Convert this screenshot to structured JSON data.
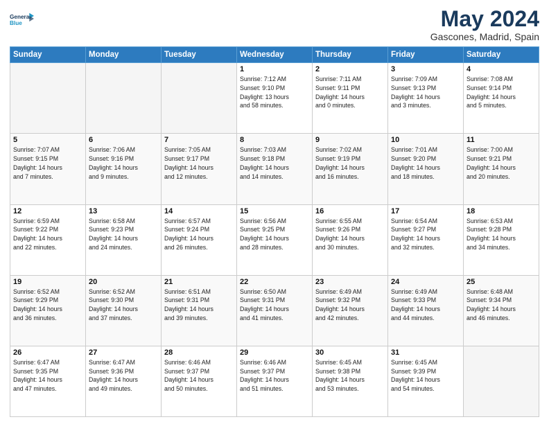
{
  "header": {
    "logo_line1": "General",
    "logo_line2": "Blue",
    "month": "May 2024",
    "location": "Gascones, Madrid, Spain"
  },
  "weekdays": [
    "Sunday",
    "Monday",
    "Tuesday",
    "Wednesday",
    "Thursday",
    "Friday",
    "Saturday"
  ],
  "weeks": [
    [
      {
        "day": "",
        "info": ""
      },
      {
        "day": "",
        "info": ""
      },
      {
        "day": "",
        "info": ""
      },
      {
        "day": "1",
        "info": "Sunrise: 7:12 AM\nSunset: 9:10 PM\nDaylight: 13 hours\nand 58 minutes."
      },
      {
        "day": "2",
        "info": "Sunrise: 7:11 AM\nSunset: 9:11 PM\nDaylight: 14 hours\nand 0 minutes."
      },
      {
        "day": "3",
        "info": "Sunrise: 7:09 AM\nSunset: 9:13 PM\nDaylight: 14 hours\nand 3 minutes."
      },
      {
        "day": "4",
        "info": "Sunrise: 7:08 AM\nSunset: 9:14 PM\nDaylight: 14 hours\nand 5 minutes."
      }
    ],
    [
      {
        "day": "5",
        "info": "Sunrise: 7:07 AM\nSunset: 9:15 PM\nDaylight: 14 hours\nand 7 minutes."
      },
      {
        "day": "6",
        "info": "Sunrise: 7:06 AM\nSunset: 9:16 PM\nDaylight: 14 hours\nand 9 minutes."
      },
      {
        "day": "7",
        "info": "Sunrise: 7:05 AM\nSunset: 9:17 PM\nDaylight: 14 hours\nand 12 minutes."
      },
      {
        "day": "8",
        "info": "Sunrise: 7:03 AM\nSunset: 9:18 PM\nDaylight: 14 hours\nand 14 minutes."
      },
      {
        "day": "9",
        "info": "Sunrise: 7:02 AM\nSunset: 9:19 PM\nDaylight: 14 hours\nand 16 minutes."
      },
      {
        "day": "10",
        "info": "Sunrise: 7:01 AM\nSunset: 9:20 PM\nDaylight: 14 hours\nand 18 minutes."
      },
      {
        "day": "11",
        "info": "Sunrise: 7:00 AM\nSunset: 9:21 PM\nDaylight: 14 hours\nand 20 minutes."
      }
    ],
    [
      {
        "day": "12",
        "info": "Sunrise: 6:59 AM\nSunset: 9:22 PM\nDaylight: 14 hours\nand 22 minutes."
      },
      {
        "day": "13",
        "info": "Sunrise: 6:58 AM\nSunset: 9:23 PM\nDaylight: 14 hours\nand 24 minutes."
      },
      {
        "day": "14",
        "info": "Sunrise: 6:57 AM\nSunset: 9:24 PM\nDaylight: 14 hours\nand 26 minutes."
      },
      {
        "day": "15",
        "info": "Sunrise: 6:56 AM\nSunset: 9:25 PM\nDaylight: 14 hours\nand 28 minutes."
      },
      {
        "day": "16",
        "info": "Sunrise: 6:55 AM\nSunset: 9:26 PM\nDaylight: 14 hours\nand 30 minutes."
      },
      {
        "day": "17",
        "info": "Sunrise: 6:54 AM\nSunset: 9:27 PM\nDaylight: 14 hours\nand 32 minutes."
      },
      {
        "day": "18",
        "info": "Sunrise: 6:53 AM\nSunset: 9:28 PM\nDaylight: 14 hours\nand 34 minutes."
      }
    ],
    [
      {
        "day": "19",
        "info": "Sunrise: 6:52 AM\nSunset: 9:29 PM\nDaylight: 14 hours\nand 36 minutes."
      },
      {
        "day": "20",
        "info": "Sunrise: 6:52 AM\nSunset: 9:30 PM\nDaylight: 14 hours\nand 37 minutes."
      },
      {
        "day": "21",
        "info": "Sunrise: 6:51 AM\nSunset: 9:31 PM\nDaylight: 14 hours\nand 39 minutes."
      },
      {
        "day": "22",
        "info": "Sunrise: 6:50 AM\nSunset: 9:31 PM\nDaylight: 14 hours\nand 41 minutes."
      },
      {
        "day": "23",
        "info": "Sunrise: 6:49 AM\nSunset: 9:32 PM\nDaylight: 14 hours\nand 42 minutes."
      },
      {
        "day": "24",
        "info": "Sunrise: 6:49 AM\nSunset: 9:33 PM\nDaylight: 14 hours\nand 44 minutes."
      },
      {
        "day": "25",
        "info": "Sunrise: 6:48 AM\nSunset: 9:34 PM\nDaylight: 14 hours\nand 46 minutes."
      }
    ],
    [
      {
        "day": "26",
        "info": "Sunrise: 6:47 AM\nSunset: 9:35 PM\nDaylight: 14 hours\nand 47 minutes."
      },
      {
        "day": "27",
        "info": "Sunrise: 6:47 AM\nSunset: 9:36 PM\nDaylight: 14 hours\nand 49 minutes."
      },
      {
        "day": "28",
        "info": "Sunrise: 6:46 AM\nSunset: 9:37 PM\nDaylight: 14 hours\nand 50 minutes."
      },
      {
        "day": "29",
        "info": "Sunrise: 6:46 AM\nSunset: 9:37 PM\nDaylight: 14 hours\nand 51 minutes."
      },
      {
        "day": "30",
        "info": "Sunrise: 6:45 AM\nSunset: 9:38 PM\nDaylight: 14 hours\nand 53 minutes."
      },
      {
        "day": "31",
        "info": "Sunrise: 6:45 AM\nSunset: 9:39 PM\nDaylight: 14 hours\nand 54 minutes."
      },
      {
        "day": "",
        "info": ""
      }
    ]
  ]
}
